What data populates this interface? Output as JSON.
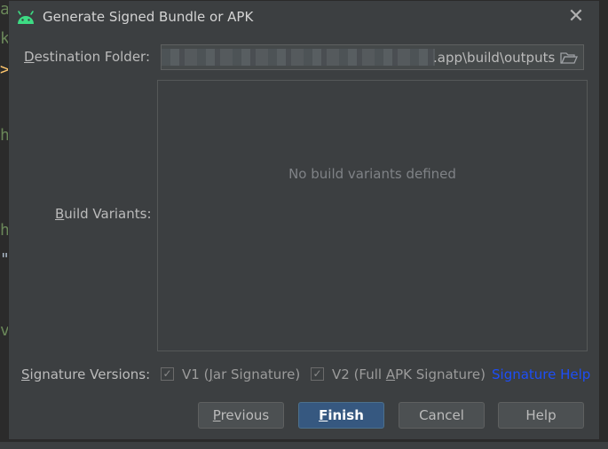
{
  "window": {
    "title": "Generate Signed Bundle or APK"
  },
  "destination": {
    "label_mnemonic": "D",
    "label_rest": "estination Folder:",
    "path_visible": ".app\\build\\outputs"
  },
  "build_variants": {
    "label_mnemonic": "B",
    "label_rest": "uild Variants:",
    "empty_text": "No build variants defined"
  },
  "signature": {
    "label_mnemonic": "S",
    "label_rest": "ignature Versions:",
    "v1": {
      "pre": "V1 (",
      "mnemonic": "J",
      "post": "ar Signature)",
      "checked": true,
      "check_glyph": "✓"
    },
    "v2": {
      "pre": "V2 (Full ",
      "mnemonic": "A",
      "post": "PK Signature)",
      "checked": true,
      "check_glyph": "✓"
    },
    "help_link": "Signature Help"
  },
  "buttons": {
    "previous": {
      "mnemonic": "P",
      "rest": "revious"
    },
    "finish": {
      "mnemonic": "F",
      "rest": "inish"
    },
    "cancel": "Cancel",
    "help": "Help"
  },
  "icons": {
    "android": "android-icon",
    "close": "close-icon",
    "folder": "folder-open-icon",
    "close_glyph": "✕"
  },
  "background_editor": {
    "chars": [
      "a",
      "k",
      ">",
      "h",
      "h",
      "\"",
      "v"
    ]
  },
  "colors": {
    "dialog_bg": "#3c3f41",
    "primary_button": "#365880",
    "link": "#1d4ef7",
    "android_green": "#3ddc84"
  }
}
